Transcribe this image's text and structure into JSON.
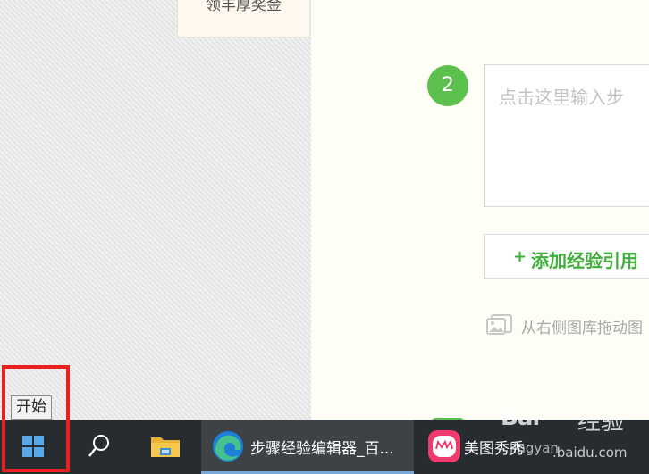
{
  "background": {
    "reward_card": {
      "text": "领丰厚奖金"
    }
  },
  "editor": {
    "step_number": "2",
    "step_placeholder": "点击这里输入步",
    "add_reference_plus": "+",
    "add_reference_label": "添加经验引用",
    "image_drag_hint": "从右侧图库拖动图"
  },
  "tooltip": {
    "text": "开始"
  },
  "taskbar": {
    "start_icon": "windows-logo-icon",
    "search_icon": "search-icon",
    "explorer_icon": "file-explorer-icon",
    "edge_window_title": "步骤经验编辑器_百...",
    "meitu_window_title": "美图秀秀"
  },
  "watermark": {
    "logo": "Bai",
    "logo_sub": "经验",
    "domain_a": "jingyan",
    "domain_b": ".baidu.com"
  },
  "colors": {
    "accent_green": "#5cc04d",
    "link_green": "#3fae3a",
    "highlight_red": "#ea1f1f",
    "taskbar_bg": "#262c30",
    "active_task_bg": "#3c4246"
  }
}
